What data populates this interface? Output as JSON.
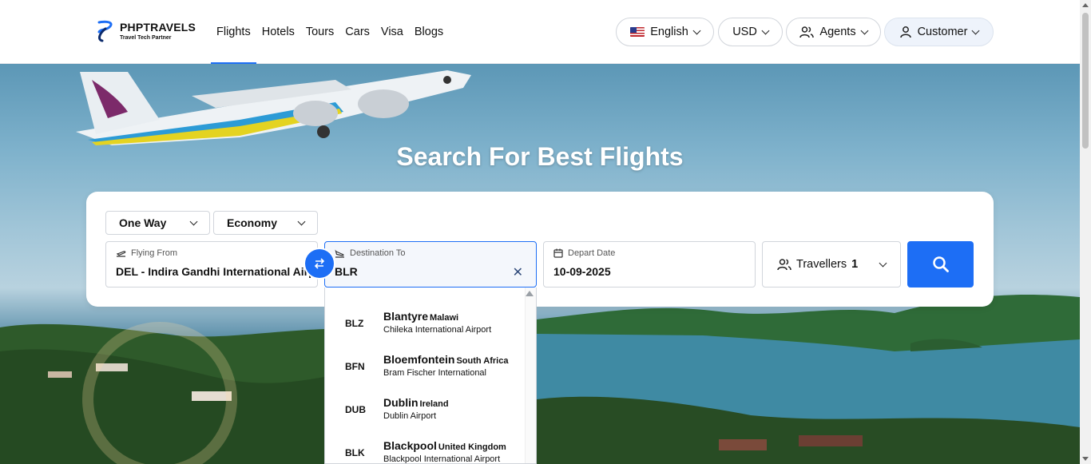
{
  "brand": {
    "name": "PHPTRAVELS",
    "tagline": "Travel Tech Partner"
  },
  "nav": {
    "items": [
      {
        "label": "Flights",
        "active": true
      },
      {
        "label": "Hotels"
      },
      {
        "label": "Tours"
      },
      {
        "label": "Cars"
      },
      {
        "label": "Visa"
      },
      {
        "label": "Blogs"
      }
    ]
  },
  "header_controls": {
    "language": "English",
    "currency": "USD",
    "agents": "Agents",
    "customer": "Customer"
  },
  "hero": {
    "title": "Search For Best Flights"
  },
  "search": {
    "trip_type": "One Way",
    "cabin_class": "Economy",
    "from": {
      "label": "Flying From",
      "value": "DEL - Indira Gandhi International Airp"
    },
    "to": {
      "label": "Destination To",
      "value": "BLR"
    },
    "depart": {
      "label": "Depart Date",
      "value": "10-09-2025"
    },
    "travellers": {
      "label": "Travellers",
      "count": "1"
    }
  },
  "suggestions": [
    {
      "code": "BLZ",
      "city": "Blantyre",
      "country": "Malawi",
      "airport": "Chileka International Airport"
    },
    {
      "code": "BFN",
      "city": "Bloemfontein",
      "country": "South Africa",
      "airport": "Bram Fischer International"
    },
    {
      "code": "DUB",
      "city": "Dublin",
      "country": "Ireland",
      "airport": "Dublin Airport"
    },
    {
      "code": "BLK",
      "city": "Blackpool",
      "country": "United Kingdom",
      "airport": "Blackpool International Airport"
    }
  ],
  "colors": {
    "accent": "#1d6ef5",
    "header_bg": "#ffffff",
    "card_bg": "#ffffff"
  },
  "icons": {
    "language": "us-flag-icon",
    "agents": "users-icon",
    "customer": "user-icon",
    "from": "plane-takeoff-icon",
    "to": "plane-landing-icon",
    "depart": "calendar-icon",
    "travellers": "users-icon",
    "swap": "swap-arrows-icon",
    "search": "search-icon",
    "clear": "close-icon"
  }
}
